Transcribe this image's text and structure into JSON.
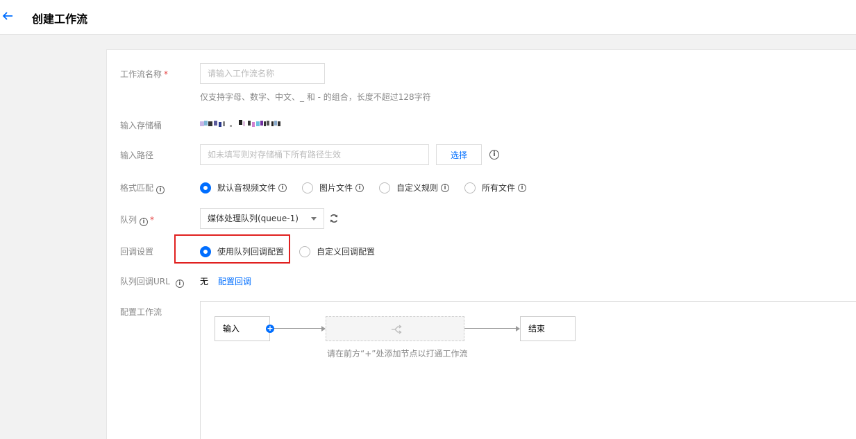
{
  "header": {
    "title": "创建工作流",
    "back_icon": "arrow-left-icon"
  },
  "form": {
    "name": {
      "label": "工作流名称",
      "required_mark": "*",
      "placeholder": "请输入工作流名称",
      "value": "",
      "hint": "仅支持字母、数字、中文、_ 和 - 的组合，长度不超过128字符"
    },
    "bucket": {
      "label": "输入存储桶"
    },
    "path": {
      "label": "输入路径",
      "placeholder": "如未填写则对存储桶下所有路径生效",
      "value": "",
      "select_button": "选择"
    },
    "format": {
      "label": "格式匹配",
      "options": [
        {
          "label": "默认音视频文件",
          "checked": true
        },
        {
          "label": "图片文件",
          "checked": false
        },
        {
          "label": "自定义规则",
          "checked": false
        },
        {
          "label": "所有文件",
          "checked": false
        }
      ]
    },
    "queue": {
      "label": "队列",
      "required_mark": "*",
      "selected": "媒体处理队列(queue-1)"
    },
    "callback": {
      "label": "回调设置",
      "options": [
        {
          "label": "使用队列回调配置",
          "checked": true
        },
        {
          "label": "自定义回调配置",
          "checked": false
        }
      ]
    },
    "queue_callback_url": {
      "label": "队列回调URL",
      "value": "无",
      "link": "配置回调"
    },
    "workflow": {
      "label": "配置工作流",
      "input_node": "输入",
      "end_node": "结束",
      "hint": "请在前方“+”处添加节点以打通工作流"
    }
  },
  "colors": {
    "accent": "#006eff",
    "highlight": "#e0201f",
    "required": "#e54545"
  }
}
